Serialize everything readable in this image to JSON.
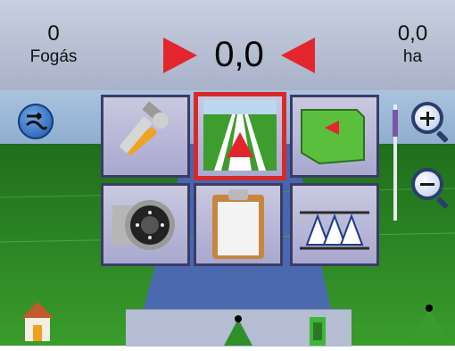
{
  "header": {
    "passes": {
      "value": "0",
      "label": "Fogás"
    },
    "cross_track": {
      "value": "0,0"
    },
    "area": {
      "value": "0,0",
      "label": "ha"
    }
  },
  "menu": {
    "tiles": [
      {
        "id": "tools",
        "icon": "wrench-hammer-icon",
        "selected": false
      },
      {
        "id": "guidance",
        "icon": "guidance-road-icon",
        "selected": true
      },
      {
        "id": "mapping",
        "icon": "field-map-icon",
        "selected": false
      },
      {
        "id": "camera",
        "icon": "camera-icon",
        "selected": false
      },
      {
        "id": "notes",
        "icon": "clipboard-icon",
        "selected": false
      },
      {
        "id": "boom",
        "icon": "boom-section-icon",
        "selected": false
      }
    ]
  },
  "controls": {
    "left": "guidance-pattern-icon",
    "zoom_in": "zoom-in-icon",
    "zoom_out": "zoom-out-icon",
    "home": "home-icon"
  },
  "colors": {
    "accent_red": "#e3262d",
    "header_bg": "#b3bbd0",
    "field_green": "#2e8a24",
    "tile_bg": "#b9b8d8",
    "tile_border": "#3b3b67",
    "selected_border": "#d62a2a"
  }
}
